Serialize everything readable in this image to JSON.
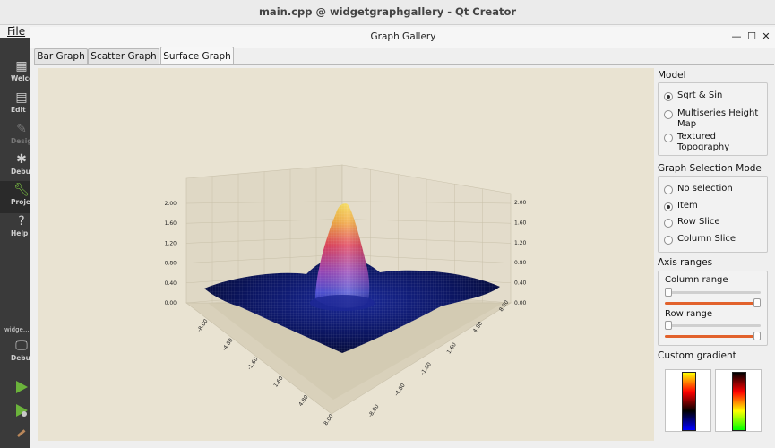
{
  "qt_creator": {
    "window_title": "main.cpp @ widgetgraphgallery - Qt Creator",
    "menu_file": "File",
    "modes": [
      {
        "label": "Welco",
        "icon": "welcome-icon"
      },
      {
        "label": "Edit",
        "icon": "edit-icon"
      },
      {
        "label": "Desig",
        "icon": "design-icon"
      },
      {
        "label": "Debu",
        "icon": "debug-icon"
      },
      {
        "label": "Projec",
        "icon": "projects-icon"
      },
      {
        "label": "Help",
        "icon": "help-icon"
      }
    ],
    "kit_label": "widge...ll",
    "kit_mode_label": "Debu"
  },
  "dialog": {
    "title": "Graph Gallery",
    "tabs": [
      {
        "label": "Bar Graph",
        "active": false
      },
      {
        "label": "Scatter Graph",
        "active": false
      },
      {
        "label": "Surface Graph",
        "active": true
      }
    ]
  },
  "controls": {
    "model": {
      "title": "Model",
      "options": [
        {
          "label": "Sqrt & Sin",
          "checked": true
        },
        {
          "label": "Multiseries Height Map",
          "checked": false
        },
        {
          "label": "Textured Topography",
          "checked": false
        }
      ]
    },
    "selection": {
      "title": "Graph Selection Mode",
      "options": [
        {
          "label": "No selection",
          "checked": false
        },
        {
          "label": "Item",
          "checked": true
        },
        {
          "label": "Row Slice",
          "checked": false
        },
        {
          "label": "Column Slice",
          "checked": false
        }
      ]
    },
    "axis_ranges": {
      "title": "Axis ranges",
      "column_label": "Column range",
      "row_label": "Row range",
      "column_range": {
        "min_fraction": 0.0,
        "max_fraction": 1.0
      },
      "row_range": {
        "min_fraction": 0.0,
        "max_fraction": 1.0
      }
    },
    "gradient": {
      "title": "Custom gradient",
      "gradient_1": [
        "#ffff00",
        "#ff0000",
        "#000000",
        "#0000ff"
      ],
      "gradient_2": [
        "#000000",
        "#ff0000",
        "#ffff00",
        "#00ff00"
      ]
    }
  },
  "chart_data": {
    "type": "surface",
    "y_ticks": [
      "0.00",
      "0.40",
      "0.80",
      "1.20",
      "1.60",
      "2.00"
    ],
    "x_ticks": [
      "-8.00",
      "-4.80",
      "-1.60",
      "1.60",
      "4.80",
      "8.00"
    ],
    "z_ticks": [
      "-8.00",
      "-4.80",
      "-1.60",
      "1.60",
      "4.80",
      "8.00"
    ],
    "ylim": [
      0,
      2
    ],
    "xlim": [
      -8,
      8
    ],
    "zlim": [
      -8,
      8
    ]
  }
}
